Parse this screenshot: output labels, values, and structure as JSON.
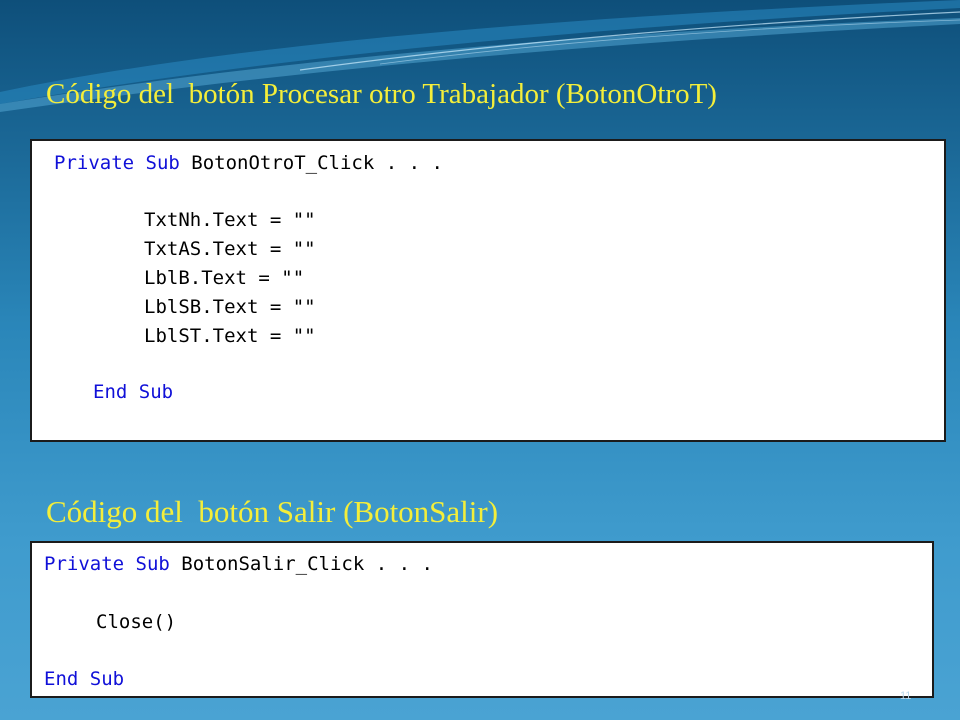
{
  "slide": {
    "heading1": "Código del  botón Procesar otro Trabajador (BotonOtroT)",
    "heading2": "Código del  botón Salir (BotonSalir)",
    "page_number": "11"
  },
  "code_block1": {
    "sub_keywords": "Private Sub",
    "sub_signature": " BotonOtroT_Click . . .",
    "lines": [
      "TxtNh.Text = \"\"",
      "TxtAS.Text = \"\"",
      "LblB.Text = \"\"",
      "LblSB.Text = \"\"",
      "LblST.Text = \"\""
    ],
    "end_keywords": "End Sub"
  },
  "code_block2": {
    "sub_keywords": "Private Sub",
    "sub_signature": " BotonSalir_Click . . .",
    "body": "Close()",
    "end_keywords": "End Sub"
  },
  "colors": {
    "heading": "#f4ee3a",
    "keyword": "#1010d8",
    "background_top": "#0e4f7a",
    "background_bottom": "#4aa3d3"
  }
}
